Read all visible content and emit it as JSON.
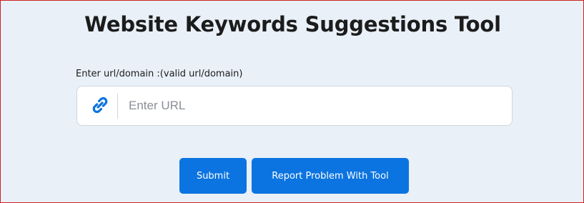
{
  "page": {
    "title": "Website Keywords Suggestions Tool"
  },
  "form": {
    "url_label": "Enter url/domain :(valid url/domain)",
    "url_placeholder": "Enter URL",
    "url_value": "",
    "input_icon": "link-icon"
  },
  "buttons": {
    "submit_label": "Submit",
    "report_label": "Report Problem With Tool"
  },
  "colors": {
    "accent": "#0b74e0",
    "background": "#e9f0f8",
    "frame_border": "#d11f1f"
  }
}
